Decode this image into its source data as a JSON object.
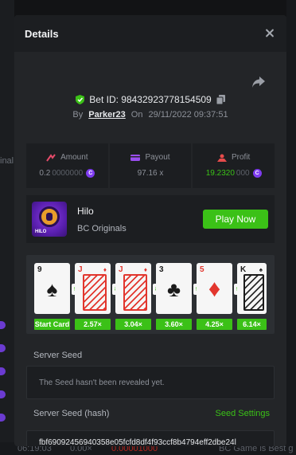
{
  "backdrop": {
    "left_text": "inal",
    "ticker_time": "06:19:03",
    "ticker_amount": "0.00×",
    "ticker_value": "0.00001000",
    "ticker_right": "BC Game is Best g"
  },
  "modal": {
    "title": "Details"
  },
  "bet": {
    "id_label": "Bet ID: 98432923778154509",
    "by_label": "By",
    "user": "Parker23",
    "on_label": "On",
    "datetime": "29/11/2022 09:37:51"
  },
  "stats": {
    "amount_label": "Amount",
    "amount_main": "0.2",
    "amount_dim": "0000000",
    "payout_label": "Payout",
    "payout_value": "97.16 x",
    "profit_label": "Profit",
    "profit_main": "19.2320",
    "profit_dim": "000",
    "coin_symbol": "C"
  },
  "game": {
    "thumb_label": "HILO",
    "name": "Hilo",
    "provider": "BC Originals",
    "play_label": "Play Now"
  },
  "cards": {
    "items": [
      {
        "rank": "9",
        "suit": "♠",
        "color": "black"
      },
      {
        "rank": "J",
        "suit": "♦",
        "color": "red"
      },
      {
        "rank": "J",
        "suit": "♦",
        "color": "red"
      },
      {
        "rank": "3",
        "suit": "♣",
        "color": "black"
      },
      {
        "rank": "5",
        "suit": "♦",
        "color": "red"
      },
      {
        "rank": "K",
        "suit": "♠",
        "color": "black"
      }
    ],
    "multipliers": [
      "Start Card",
      "2.57×",
      "3.04×",
      "3.60×",
      "4.25×",
      "6.14×"
    ]
  },
  "seeds": {
    "server_seed_label": "Server Seed",
    "server_seed_value": "The Seed hasn't been revealed yet.",
    "hash_label": "Server Seed (hash)",
    "settings_label": "Seed Settings",
    "hash_value": "fbf69092456940358e05fcfd8df4f93ccf8b4794eff2dbe24l"
  },
  "colors": {
    "accent_green": "#3bc117",
    "coin_purple": "#7f3cf0",
    "card_red": "#e2362e"
  }
}
